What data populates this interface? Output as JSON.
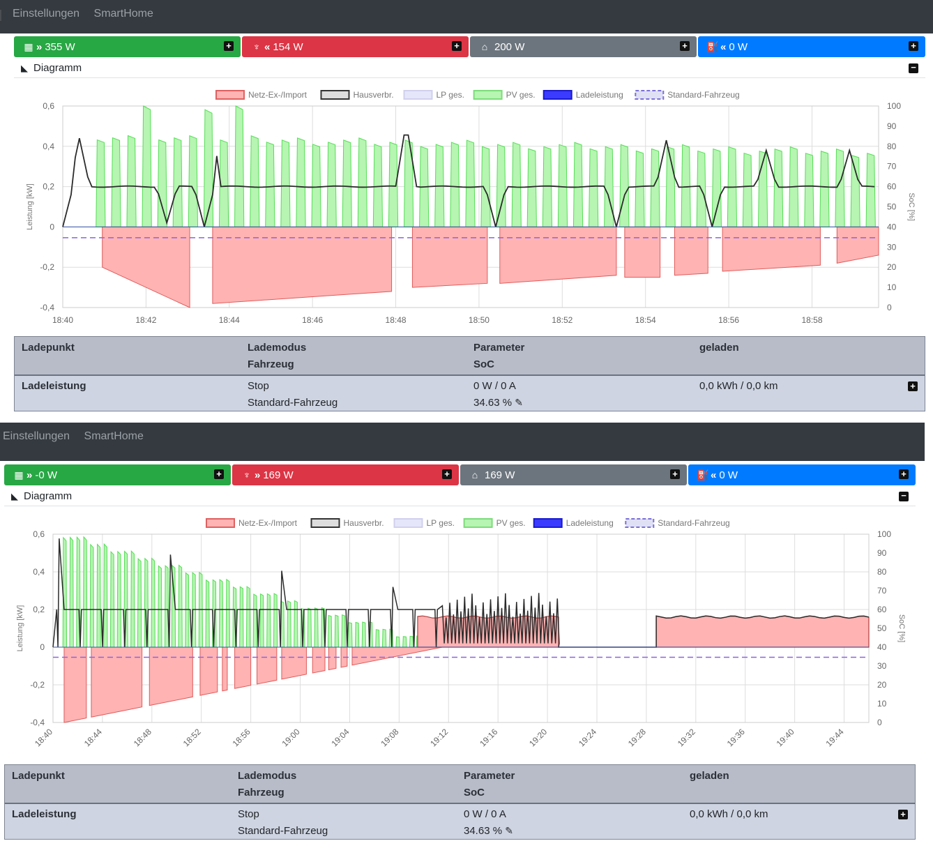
{
  "nav": [
    "Einstellungen",
    "SmartHome"
  ],
  "colors": {
    "green": "#28a745",
    "red": "#dc3545",
    "gray": "#6c757d",
    "blue": "#007bff",
    "pv_fill": "#b6f5b2",
    "pv_line": "#55dd55",
    "grid_fill": "#ffb3b3",
    "grid_line": "#e05a5a",
    "house": "#2b2b2b",
    "soc": "#8866dd"
  },
  "legend": [
    {
      "label": "Netz-Ex-/Import",
      "fill": "#ffb3b3",
      "stroke": "#e06060",
      "dash": false
    },
    {
      "label": "Hausverbr.",
      "fill": "#dddddd",
      "stroke": "#333333",
      "dash": false
    },
    {
      "label": "LP ges.",
      "fill": "#e6e6fa",
      "stroke": "#d0d0ee",
      "dash": false
    },
    {
      "label": "PV ges.",
      "fill": "#b6f5b2",
      "stroke": "#7ddc7a",
      "dash": false
    },
    {
      "label": "Ladeleistung",
      "fill": "#3b3bff",
      "stroke": "#1a1ad0",
      "dash": false
    },
    {
      "label": "Standard-Fahrzeug",
      "fill": "#e0e0f4",
      "stroke": "#7a70d8",
      "dash": true
    }
  ],
  "panels": [
    {
      "stats": [
        {
          "icon": "solar-panel-icon",
          "arrow": "»",
          "value": "355 W",
          "color": "green"
        },
        {
          "icon": "power-pylon-icon",
          "arrow": "«",
          "value": "154 W",
          "color": "red"
        },
        {
          "icon": "home-icon",
          "arrow": "",
          "value": "200 W",
          "color": "gray"
        },
        {
          "icon": "charging-car-icon",
          "arrow": "«",
          "value": "0 W",
          "color": "blue"
        }
      ],
      "diagram_label": "Diagramm",
      "chart_data": {
        "type": "area",
        "ylabel_left": "Leistung [kW]",
        "ylabel_right": "SoC [%]",
        "ylim": [
          -0.4,
          0.6
        ],
        "yticks": [
          "0,6",
          "0,4",
          "0,2",
          "0",
          "-0,2",
          "-0,4"
        ],
        "y2lim": [
          0,
          100
        ],
        "y2ticks": [
          "100",
          "90",
          "80",
          "70",
          "60",
          "50",
          "40",
          "30",
          "20",
          "10",
          "0"
        ],
        "xlim_minutes": [
          0,
          19.6
        ],
        "xticks": [
          "18:40",
          "18:42",
          "18:44",
          "18:46",
          "18:48",
          "18:50",
          "18:52",
          "18:54",
          "18:56",
          "18:58"
        ],
        "xtick_step_minutes": 2,
        "x_rotated": false,
        "grid": true,
        "series": [
          {
            "name": "PV ges.",
            "kind": "pv_pulses",
            "start": 0.8,
            "end": 19.6,
            "period": 0.37,
            "duty": 0.6,
            "peak_start": 0.45,
            "peak_end": 0.37,
            "peaks": [
              [
                1.9,
                0.6
              ],
              [
                3.4,
                0.6
              ],
              [
                4.2,
                0.6
              ]
            ]
          },
          {
            "name": "Netz-Ex-/Import",
            "kind": "grid_blocks",
            "blocks": [
              [
                0.95,
                3.05,
                -0.2,
                -0.4
              ],
              [
                3.6,
                7.9,
                -0.38,
                -0.32
              ],
              [
                8.4,
                10.2,
                -0.3,
                -0.28
              ],
              [
                10.5,
                13.3,
                -0.28,
                -0.24
              ],
              [
                13.5,
                14.35,
                -0.25,
                -0.25
              ],
              [
                14.7,
                15.5,
                -0.24,
                -0.23
              ],
              [
                15.85,
                18.2,
                -0.22,
                -0.19
              ],
              [
                18.6,
                19.6,
                -0.18,
                -0.14
              ]
            ]
          },
          {
            "name": "Hausverbr.",
            "kind": "house",
            "base": 0.2,
            "spikes": [
              [
                0.4,
                0.44
              ],
              [
                3.55,
                0.58
              ],
              [
                8.25,
                0.52
              ],
              [
                14.5,
                0.43
              ],
              [
                16.9,
                0.38
              ],
              [
                18.9,
                0.38
              ]
            ],
            "dips": [
              [
                0.0,
                0.0
              ],
              [
                2.5,
                0.02
              ],
              [
                3.4,
                0.0
              ],
              [
                10.4,
                0.0
              ],
              [
                13.3,
                0.0
              ],
              [
                15.6,
                0.0
              ]
            ]
          },
          {
            "name": "Standard-Fahrzeug",
            "kind": "soc",
            "value": 34.63
          }
        ]
      },
      "table": {
        "headers": [
          [
            "Ladepunkt",
            ""
          ],
          [
            "Lademodus",
            "Fahrzeug"
          ],
          [
            "Parameter",
            "SoC"
          ],
          [
            "geladen",
            ""
          ]
        ],
        "row": {
          "name": "Ladeleistung",
          "mode": "Stop",
          "vehicle": "Standard-Fahrzeug",
          "power": "0 W / 0 A",
          "soc": "34.63 %",
          "charged": "0,0 kWh / 0,0 km"
        }
      }
    },
    {
      "stats": [
        {
          "icon": "solar-panel-icon",
          "arrow": "»",
          "value": "-0 W",
          "color": "green"
        },
        {
          "icon": "power-pylon-icon",
          "arrow": "»",
          "value": "169 W",
          "color": "red"
        },
        {
          "icon": "home-icon",
          "arrow": "",
          "value": "169 W",
          "color": "gray"
        },
        {
          "icon": "charging-car-icon",
          "arrow": "«",
          "value": "0 W",
          "color": "blue"
        }
      ],
      "diagram_label": "Diagramm",
      "chart_data": {
        "type": "area",
        "ylabel_left": "Leistung [kW]",
        "ylabel_right": "SoC [%]",
        "ylim": [
          -0.4,
          0.6
        ],
        "yticks": [
          "0,6",
          "0,4",
          "0,2",
          "0",
          "-0,2",
          "-0,4"
        ],
        "y2lim": [
          0,
          100
        ],
        "y2ticks": [
          "100",
          "90",
          "80",
          "70",
          "60",
          "50",
          "40",
          "30",
          "20",
          "10",
          "0"
        ],
        "xlim_minutes": [
          0,
          66
        ],
        "xticks": [
          "18:40",
          "18:44",
          "18:48",
          "18:52",
          "18:56",
          "19:00",
          "19:04",
          "19:08",
          "19:12",
          "19:16",
          "19:20",
          "19:24",
          "19:28",
          "19:32",
          "19:36",
          "19:40",
          "19:44"
        ],
        "xtick_step_minutes": 4,
        "x_rotated": true,
        "grid": true,
        "series": [
          {
            "name": "PV ges.",
            "kind": "pv_pulses",
            "start": 0.8,
            "end": 31.5,
            "period": 0.55,
            "duty": 0.55,
            "peak_start": 0.6,
            "peak_end": 0.0,
            "peaks": []
          },
          {
            "name": "Netz-Ex-/Import",
            "kind": "grid_ramp",
            "start": 0.9,
            "end": 31.5,
            "v_start": -0.4,
            "v_end": 0.0,
            "gaps": [
              [
                2.7,
                3.1
              ],
              [
                7.2,
                7.8
              ],
              [
                11.3,
                11.9
              ],
              [
                13.3,
                13.7
              ],
              [
                14.1,
                14.7
              ],
              [
                16.0,
                16.5
              ],
              [
                18.1,
                18.5
              ],
              [
                20.5,
                21.0
              ],
              [
                22.0,
                22.3
              ],
              [
                22.9,
                23.3
              ],
              [
                23.8,
                24.2
              ]
            ],
            "positive": [
              [
                29.5,
                40.9,
                0.0,
                0.16
              ],
              [
                48.8,
                66.0,
                0.16,
                0.16
              ]
            ]
          },
          {
            "name": "Hausverbr.",
            "kind": "house_dense",
            "start": 0.3,
            "end": 40.9,
            "v": 0.2,
            "dense_end": 31.5,
            "tail_start": 48.8,
            "tail_v": 0.16
          },
          {
            "name": "Standard-Fahrzeug",
            "kind": "soc",
            "value": 34.63
          }
        ]
      },
      "table": {
        "headers": [
          [
            "Ladepunkt",
            ""
          ],
          [
            "Lademodus",
            "Fahrzeug"
          ],
          [
            "Parameter",
            "SoC"
          ],
          [
            "geladen",
            ""
          ]
        ],
        "row": {
          "name": "Ladeleistung",
          "mode": "Stop",
          "vehicle": "Standard-Fahrzeug",
          "power": "0 W / 0 A",
          "soc": "34.63 %",
          "charged": "0,0 kWh / 0,0 km"
        }
      }
    }
  ]
}
